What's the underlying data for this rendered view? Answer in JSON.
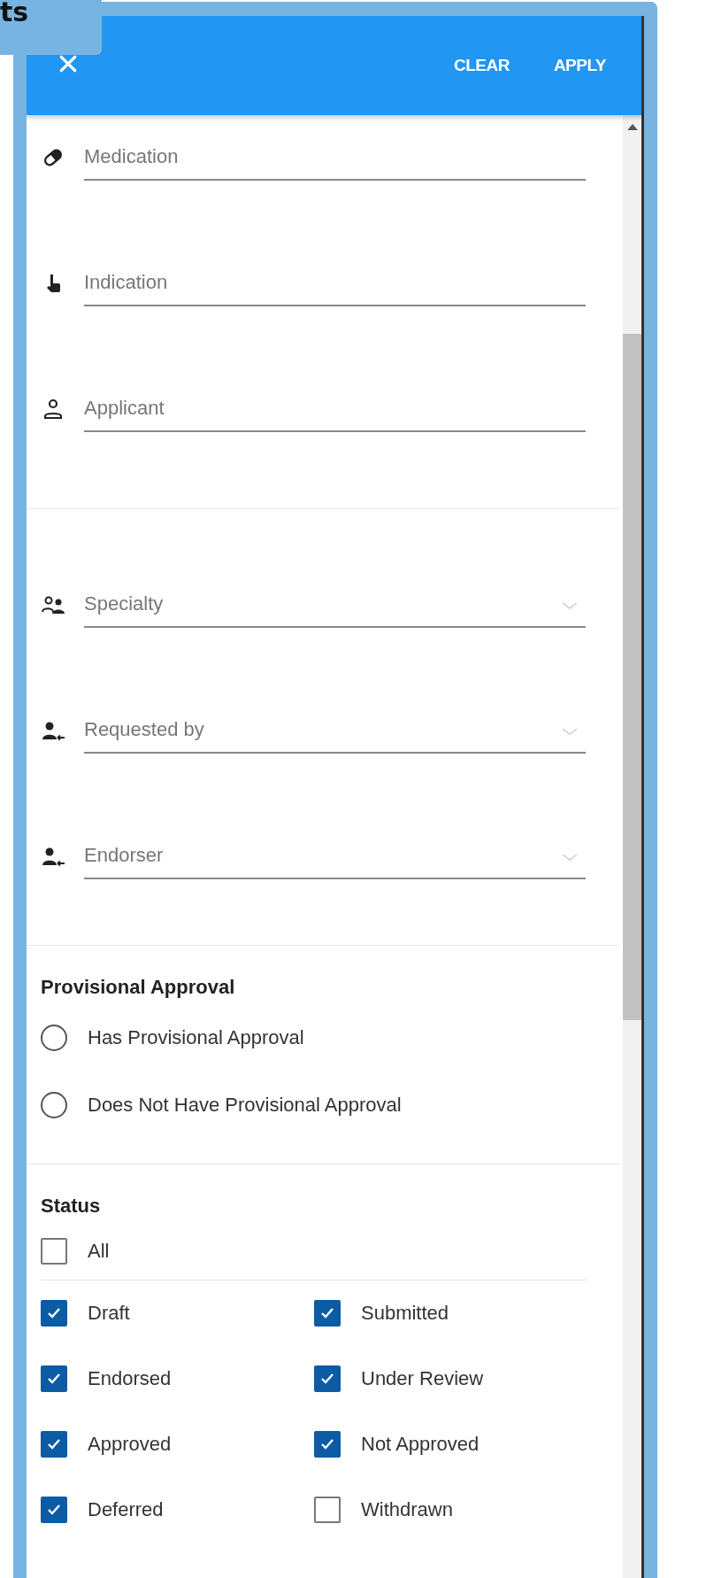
{
  "background_tab": {
    "text": "ts"
  },
  "header": {
    "buttons": [
      "CLEAR",
      "APPLY"
    ]
  },
  "field_groups": [
    {
      "fields": [
        {
          "placeholder": "Medication",
          "kind": "text"
        },
        {
          "placeholder": "Indication",
          "kind": "text"
        },
        {
          "placeholder": "Applicant",
          "kind": "text"
        }
      ]
    },
    {
      "fields": [
        {
          "placeholder": "Specialty",
          "kind": "dropdown"
        },
        {
          "placeholder": "Requested by",
          "kind": "dropdown"
        },
        {
          "placeholder": "Endorser",
          "kind": "dropdown"
        }
      ]
    }
  ],
  "provisional_approval": {
    "title": "Provisional Approval",
    "options": [
      {
        "label": "Has Provisional Approval",
        "selected": false
      },
      {
        "label": "Does Not Have Provisional Approval",
        "selected": false
      }
    ]
  },
  "status": {
    "title": "Status",
    "all": {
      "label": "All",
      "checked": false
    },
    "options": [
      {
        "label": "Draft",
        "checked": true
      },
      {
        "label": "Submitted",
        "checked": true
      },
      {
        "label": "Endorsed",
        "checked": true
      },
      {
        "label": "Under Review",
        "checked": true
      },
      {
        "label": "Approved",
        "checked": true
      },
      {
        "label": "Not Approved",
        "checked": true
      },
      {
        "label": "Deferred",
        "checked": true
      },
      {
        "label": "Withdrawn",
        "checked": false
      }
    ]
  }
}
